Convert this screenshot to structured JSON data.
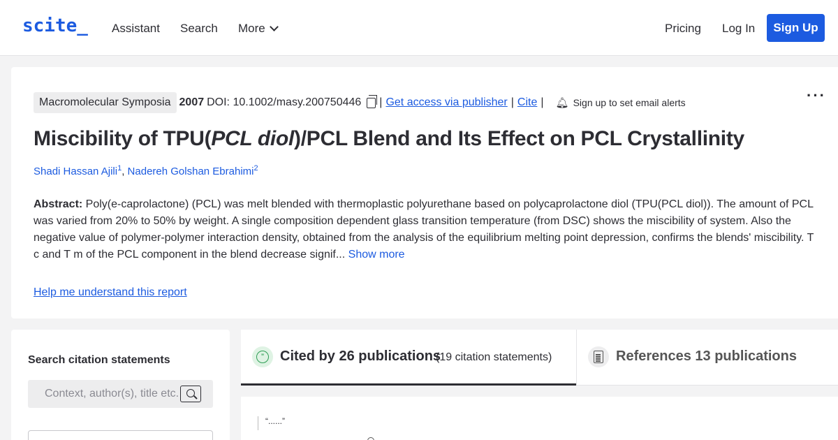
{
  "header": {
    "logo": "scite_",
    "nav": {
      "assistant": "Assistant",
      "search": "Search",
      "more": "More"
    },
    "pricing": "Pricing",
    "login": "Log In",
    "signup": "Sign Up"
  },
  "paper": {
    "journal": "Macromolecular Symposia",
    "year": "2007",
    "doi": "DOI: 10.1002/masy.200750446",
    "access_link": "Get access via publisher",
    "cite_link": "Cite",
    "alerts": "Sign up to set email alerts",
    "title_pre": "Miscibility of TPU(",
    "title_italic": "PCL diol",
    "title_post": ")/PCL Blend and Its Effect on PCL Crystallinity",
    "authors": [
      {
        "name": "Shadi Hassan Ajili",
        "sup": "1"
      },
      {
        "name": "Nadereh Golshan Ebrahimi",
        "sup": "2"
      }
    ],
    "abstract_label": "Abstract:",
    "abstract_text": " Poly(e-caprolactone) (PCL) was melt blended with thermoplastic polyurethane based on polycaprolactone diol (TPU(PCL diol)). The amount of PCL was varied from 20% to 50% by weight. A single composition dependent glass transition temperature (from DSC) shows the miscibility of system. Also the negative value of polymer-polymer interaction density, obtained from the analysis of the equilibrium melting point depression, confirms the blends' miscibility. T c and T m of the PCL component in the blend decrease signif...",
    "show_more": " Show more",
    "help_link": "Help me understand this report"
  },
  "search_panel": {
    "title": "Search citation statements",
    "placeholder": "Context, author(s), title etc."
  },
  "tabs": {
    "cited_by": "Cited by 26 publications",
    "cited_by_sub": "(19 citation statements)",
    "references": "References 13 publications"
  },
  "results": {
    "quote": "“......”"
  }
}
